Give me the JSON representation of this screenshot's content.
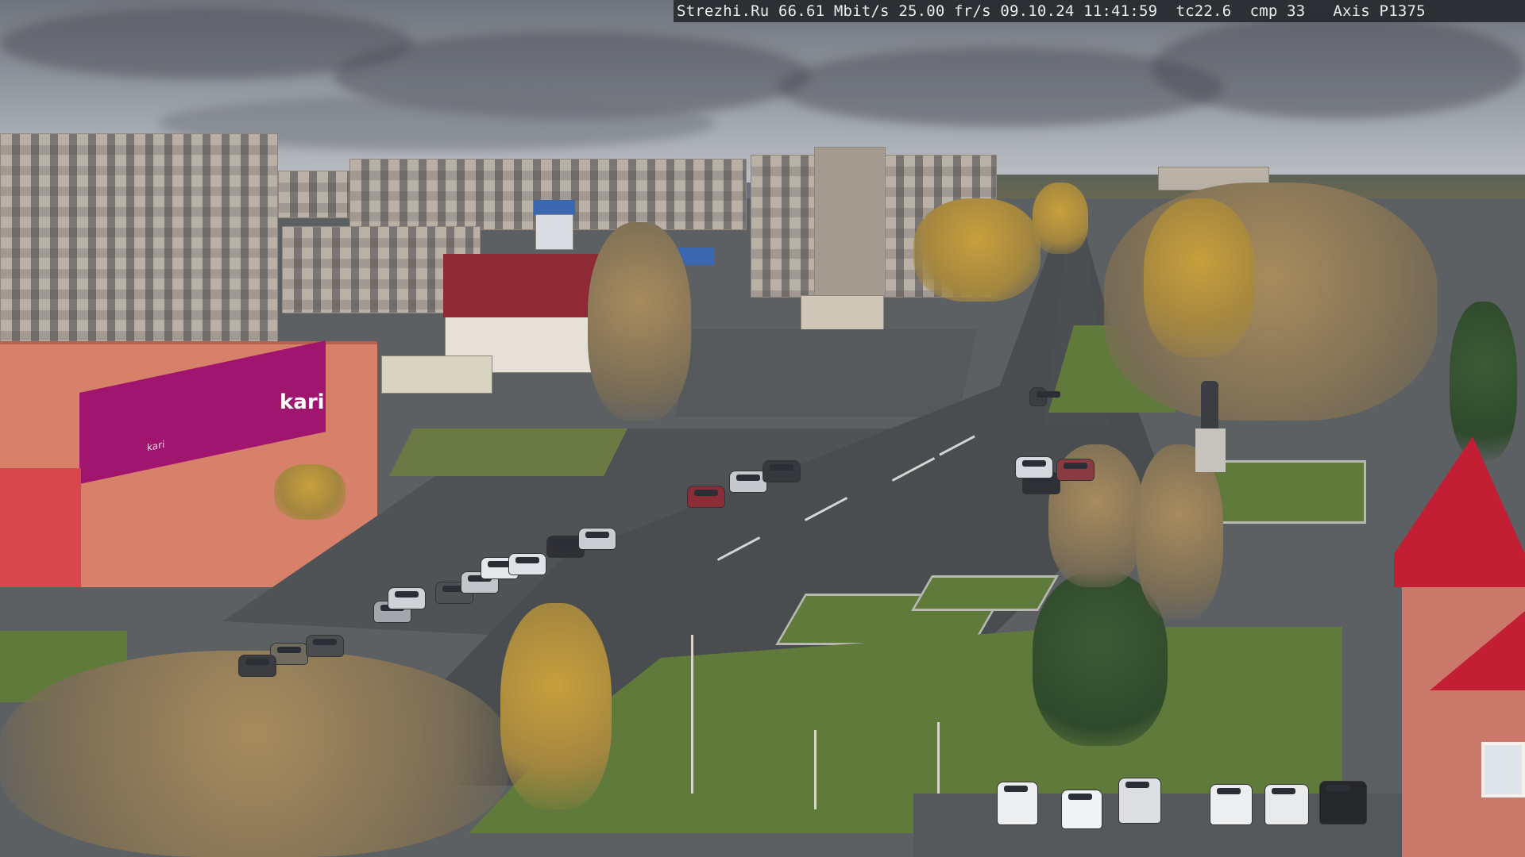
{
  "overlay": {
    "text": "Strezhi.Ru 66.61 Mbit/s 25.00 fr/s 09.10.24 11:41:59  tc22.6  cmp 33   Axis P1375"
  },
  "signs": {
    "store_logo": "kari",
    "store_tagline": "kari"
  },
  "colors": {
    "sky": "#8d929a",
    "road": "#4a4d50",
    "lawn": "#5f7a3a",
    "mall_facade": "#d7816a",
    "mall_sign": "#a0166f",
    "roof_red": "#c21f35"
  }
}
